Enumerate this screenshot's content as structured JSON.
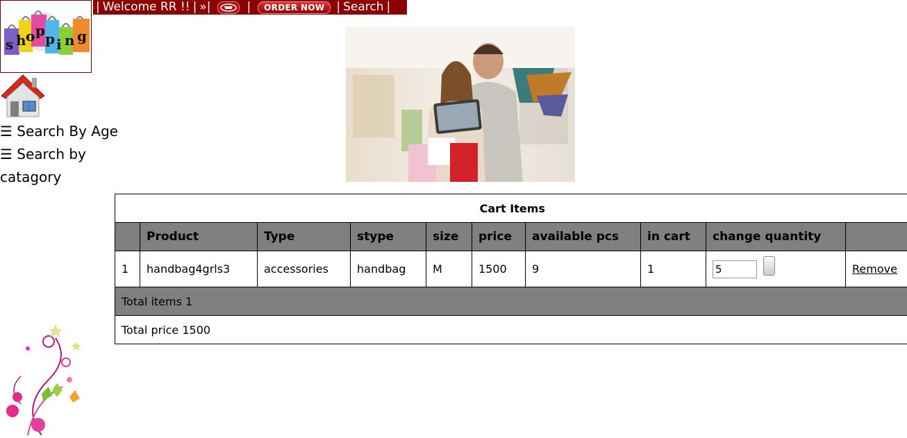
{
  "logo": {
    "letters": [
      "s",
      "h",
      "o",
      "p",
      "p",
      "i",
      "n",
      "g"
    ]
  },
  "topbar": {
    "pipe": "|",
    "welcome": "Welcome RR !!",
    "arrow": "»|",
    "order_now": "ORDER NOW",
    "search": "Search"
  },
  "sidebar": {
    "items": [
      {
        "label": "☰ Search By Age"
      },
      {
        "label": "☰ Search by catagory"
      }
    ]
  },
  "cart": {
    "title": "Cart Items",
    "headers": [
      "",
      "Product",
      "Type",
      "stype",
      "size",
      "price",
      "available pcs",
      "in cart",
      "change quantity",
      ""
    ],
    "rows": [
      {
        "index": "1",
        "product": "handbag4grls3",
        "type": "accessories",
        "stype": "handbag",
        "size": "M",
        "price": "1500",
        "available": "9",
        "in_cart": "1",
        "quantity": "5",
        "remove": "Remove"
      }
    ],
    "total_items": "Total items 1",
    "total_price": "Total price 1500"
  },
  "colors": {
    "topbar_bg": "#8b0000",
    "header_bg": "#808080"
  }
}
